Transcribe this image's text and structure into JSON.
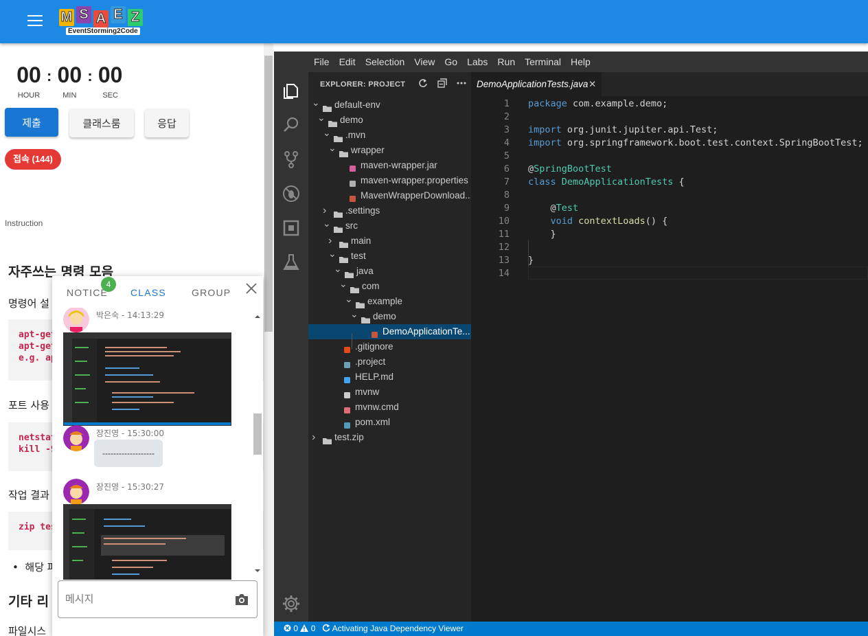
{
  "app": {
    "logo_letters": [
      "M",
      "S",
      "A",
      "E",
      "Z"
    ],
    "logo_colors": [
      "#f4b400",
      "#8e44ad",
      "#e74c3c",
      "#3498db",
      "#2ecc71"
    ],
    "logo_sub": "EventStorming2Code",
    "brand_color": "#1e88e5"
  },
  "timer": {
    "hours": "00",
    "minutes": "00",
    "seconds": "00",
    "hour_label": "HOUR",
    "min_label": "MIN",
    "sec_label": "SEC"
  },
  "actions": {
    "submit": "제출",
    "classroom": "클래스룸",
    "answer": "응답"
  },
  "connections": "접속 (144)",
  "instruction": {
    "label": "Instruction",
    "heading1": "자주쓰는 명령 모음",
    "p1": "명령어 설",
    "code1": "apt-get\napt-get\ne.g. ap",
    "p2": "포트 사용",
    "code2": "netstat\nkill -9",
    "p3": "작업 결과",
    "code3": "zip tes",
    "bullet1": "해당 파",
    "heading2": "기타 리",
    "p4": "파일시스"
  },
  "chat": {
    "tabs": [
      "NOTICE",
      "CLASS",
      "GROUP"
    ],
    "active_tab": "CLASS",
    "notice_badge": "4",
    "messages": [
      {
        "sender": "박은숙",
        "time": "14:13:29",
        "type": "image"
      },
      {
        "sender": "장진영",
        "time": "15:30:00",
        "type": "text",
        "text": "-------------------"
      },
      {
        "sender": "장진영",
        "time": "15:30:27",
        "type": "image"
      }
    ],
    "input_placeholder": "메시지",
    "camera_icon": "camera-icon"
  },
  "vscode": {
    "menu": [
      "File",
      "Edit",
      "Selection",
      "View",
      "Go",
      "Labs",
      "Run",
      "Terminal",
      "Help"
    ],
    "explorer_title": "EXPLORER: PROJECT",
    "tree": [
      {
        "label": "default-env",
        "depth": 0,
        "kind": "folder",
        "open": true
      },
      {
        "label": "demo",
        "depth": 1,
        "kind": "folder",
        "open": true
      },
      {
        "label": ".mvn",
        "depth": 2,
        "kind": "folder",
        "open": true
      },
      {
        "label": "wrapper",
        "depth": 3,
        "kind": "folder",
        "open": true
      },
      {
        "label": "maven-wrapper.jar",
        "depth": 4,
        "kind": "jar"
      },
      {
        "label": "maven-wrapper.properties",
        "depth": 4,
        "kind": "props"
      },
      {
        "label": "MavenWrapperDownload...",
        "depth": 4,
        "kind": "java"
      },
      {
        "label": ".settings",
        "depth": 2,
        "kind": "folder",
        "open": false
      },
      {
        "label": "src",
        "depth": 2,
        "kind": "folder",
        "open": true
      },
      {
        "label": "main",
        "depth": 3,
        "kind": "folder",
        "open": false
      },
      {
        "label": "test",
        "depth": 3,
        "kind": "folder",
        "open": true
      },
      {
        "label": "java",
        "depth": 4,
        "kind": "folder",
        "open": true
      },
      {
        "label": "com",
        "depth": 5,
        "kind": "folder",
        "open": true
      },
      {
        "label": "example",
        "depth": 6,
        "kind": "folder",
        "open": true
      },
      {
        "label": "demo",
        "depth": 7,
        "kind": "folder",
        "open": true
      },
      {
        "label": "DemoApplicationTe...",
        "depth": 8,
        "kind": "java",
        "selected": true
      },
      {
        "label": ".gitignore",
        "depth": 3,
        "kind": "git"
      },
      {
        "label": ".project",
        "depth": 3,
        "kind": "project"
      },
      {
        "label": "HELP.md",
        "depth": 3,
        "kind": "md"
      },
      {
        "label": "mvnw",
        "depth": 3,
        "kind": "file"
      },
      {
        "label": "mvnw.cmd",
        "depth": 3,
        "kind": "cmd"
      },
      {
        "label": "pom.xml",
        "depth": 3,
        "kind": "xml"
      },
      {
        "label": "test.zip",
        "depth": 0,
        "kind": "folder",
        "open": false
      }
    ],
    "editor_tab": "DemoApplicationTests.java",
    "code_lines": [
      [
        [
          "kw",
          "package"
        ],
        [
          "t",
          " com.example.demo;"
        ]
      ],
      [],
      [
        [
          "kw",
          "import"
        ],
        [
          "t",
          " org.junit.jupiter.api.Test;"
        ]
      ],
      [
        [
          "kw",
          "import"
        ],
        [
          "t",
          " org.springframework.boot.test.context.SpringBootTest;"
        ]
      ],
      [],
      [
        [
          "t",
          "@"
        ],
        [
          "ty",
          "SpringBootTest"
        ]
      ],
      [
        [
          "kw",
          "class"
        ],
        [
          "t",
          " "
        ],
        [
          "ty",
          "DemoApplicationTests"
        ],
        [
          "t",
          " {"
        ]
      ],
      [],
      [
        [
          "t",
          "    @"
        ],
        [
          "ty",
          "Test"
        ]
      ],
      [
        [
          "t",
          "    "
        ],
        [
          "kw",
          "void"
        ],
        [
          "t",
          " "
        ],
        [
          "fn",
          "contextLoads"
        ],
        [
          "t",
          "() {"
        ]
      ],
      [
        [
          "t",
          "    }"
        ]
      ],
      [],
      [
        [
          "t",
          "}"
        ]
      ],
      []
    ],
    "status": {
      "errors": "0",
      "warnings": "0",
      "message": "Activating Java Dependency Viewer"
    }
  }
}
